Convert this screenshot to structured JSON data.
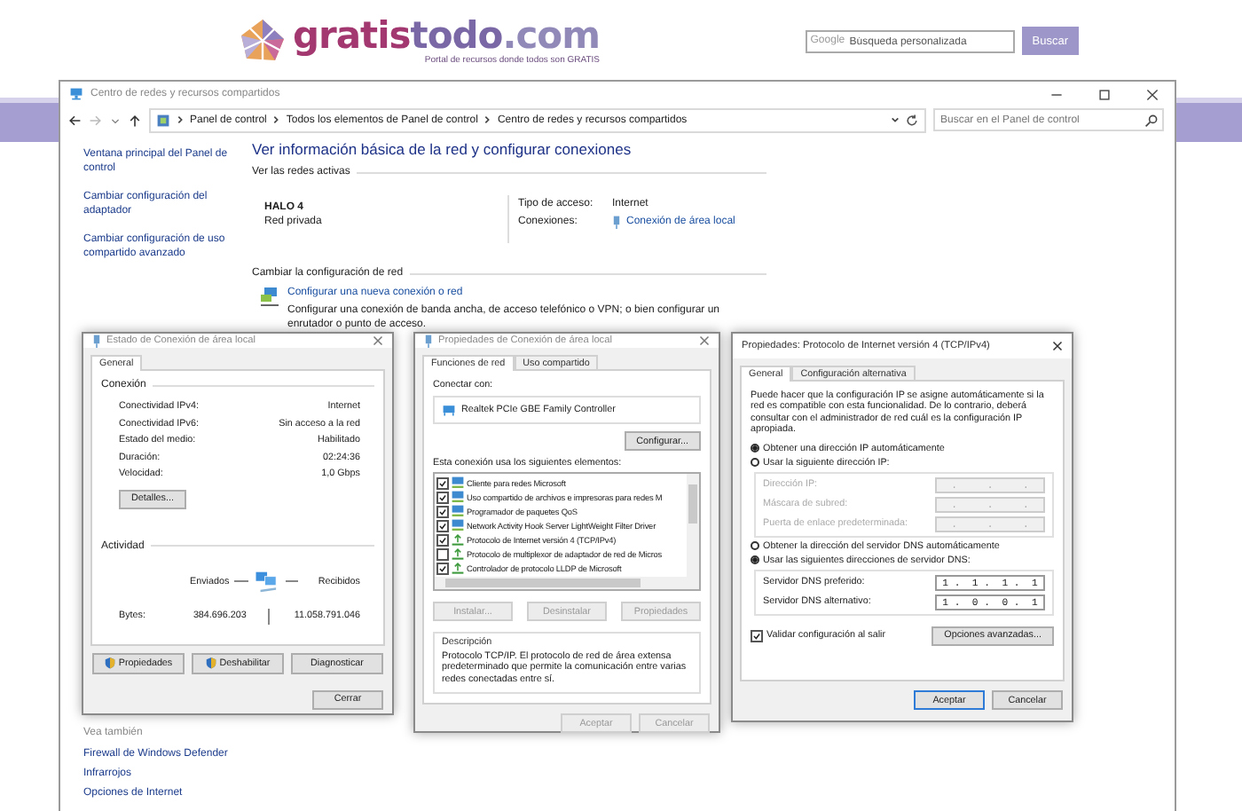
{
  "site_header": {
    "logo_parts": [
      {
        "text": "gratis",
        "color": "#a2386f"
      },
      {
        "text": "todo",
        "color": "#7a68a6"
      },
      {
        "text": ".com",
        "color": "#918ab9"
      }
    ],
    "tagline": "Portal de recursos donde todos son GRATIS",
    "search": {
      "brand": "Google",
      "placeholder": "Búsqueda personalizada"
    },
    "search_button": "Buscar"
  },
  "window": {
    "title": "Centro de redes y recursos compartidos",
    "breadcrumb": [
      "Panel de control",
      "Todos los elementos de Panel de control",
      "Centro de redes y recursos compartidos"
    ],
    "search": {
      "placeholder": "Buscar en el Panel de control"
    },
    "sidebar": {
      "items": [
        "Ventana principal del Panel de control",
        "Cambiar configuración del adaptador",
        "Cambiar configuración de uso compartido avanzado"
      ],
      "see_also_heading": "Vea también",
      "see_also": [
        "Firewall de Windows Defender",
        "Infrarrojos",
        "Opciones de Internet"
      ]
    },
    "heading": "Ver información básica de la red y configurar conexiones",
    "active_networks": {
      "heading": "Ver las redes activas",
      "name": "HALO 4",
      "category": "Red privada",
      "access_label": "Tipo de acceso:",
      "access_value": "Internet",
      "connections_label": "Conexiones:",
      "connections_value": "Conexión de área local"
    },
    "change_settings": {
      "heading": "Cambiar la configuración de red",
      "link": "Configurar una nueva conexión o red",
      "description": "Configurar una conexión de banda ancha, de acceso telefónico o VPN; o bien configurar un enrutador o punto de acceso."
    }
  },
  "status_dialog": {
    "title": "Estado de Conexión de área local",
    "tabs": [
      {
        "label": "General",
        "selected": true
      }
    ],
    "connection_heading": "Conexión",
    "rows": [
      {
        "label": "Conectividad IPv4:",
        "value": "Internet"
      },
      {
        "label": "Conectividad IPv6:",
        "value": "Sin acceso a la red"
      },
      {
        "label": "Estado del medio:",
        "value": "Habilitado"
      },
      {
        "label": "Duración:",
        "value": "02:24:36"
      },
      {
        "label": "Velocidad:",
        "value": "1,0 Gbps"
      }
    ],
    "details_button": "Detalles...",
    "activity_heading": "Actividad",
    "sent_label": "Enviados",
    "received_label": "Recibidos",
    "bytes_label": "Bytes:",
    "bytes_sent": "384.696.203",
    "bytes_received": "11.058.791.046",
    "buttons": [
      {
        "label": "Propiedades",
        "kind": "shield"
      },
      {
        "label": "Deshabilitar",
        "kind": "shield"
      },
      {
        "label": "Diagnosticar",
        "kind": "plain"
      }
    ],
    "close_button": "Cerrar"
  },
  "properties_dialog": {
    "title": "Propiedades de Conexión de área local",
    "tabs": [
      {
        "label": "Funciones de red",
        "selected": true
      },
      {
        "label": "Uso compartido",
        "selected": false
      }
    ],
    "connect_label": "Conectar con:",
    "adapter": "Realtek PCIe GBE Family Controller",
    "configure_button": "Configurar...",
    "items_label": "Esta conexión usa los siguientes elementos:",
    "items": [
      {
        "label": "Cliente para redes Microsoft",
        "checked": true,
        "kind": "client"
      },
      {
        "label": "Uso compartido de archivos e impresoras para redes M",
        "checked": true,
        "kind": "client"
      },
      {
        "label": "Programador de paquetes QoS",
        "checked": true,
        "kind": "client"
      },
      {
        "label": "Network Activity Hook Server LightWeight Filter Driver",
        "checked": true,
        "kind": "client"
      },
      {
        "label": "Protocolo de Internet versión 4 (TCP/IPv4)",
        "checked": true,
        "kind": "protocol"
      },
      {
        "label": "Protocolo de multiplexor de adaptador de red de Micros",
        "checked": false,
        "kind": "protocol"
      },
      {
        "label": "Controlador de protocolo LLDP de Microsoft",
        "checked": true,
        "kind": "protocol"
      }
    ],
    "item_buttons": [
      {
        "label": "Instalar...",
        "disabled": true
      },
      {
        "label": "Desinstalar",
        "disabled": true
      },
      {
        "label": "Propiedades",
        "disabled": true
      }
    ],
    "description_heading": "Descripción",
    "description": "Protocolo TCP/IP. El protocolo de red de área extensa predeterminado que permite la comunicación entre varias redes conectadas entre sí.",
    "footer_buttons": [
      {
        "label": "Aceptar",
        "disabled": true
      },
      {
        "label": "Cancelar",
        "disabled": true
      }
    ]
  },
  "ipv4_dialog": {
    "title": "Propiedades: Protocolo de Internet versión 4 (TCP/IPv4)",
    "tabs": [
      {
        "label": "General",
        "selected": true
      },
      {
        "label": "Configuración alternativa",
        "selected": false
      }
    ],
    "intro": "Puede hacer que la configuración IP se asigne automáticamente si la red es compatible con esta funcionalidad. De lo contrario, deberá consultar con el administrador de red cuál es la configuración IP apropiada.",
    "ip_options": [
      {
        "label": "Obtener una dirección IP automáticamente",
        "selected": true
      },
      {
        "label": "Usar la siguiente dirección IP:",
        "selected": false
      }
    ],
    "ip_fields": [
      {
        "label": "Dirección IP:",
        "value": ".     .     .",
        "disabled": true
      },
      {
        "label": "Máscara de subred:",
        "value": ".     .     .",
        "disabled": true
      },
      {
        "label": "Puerta de enlace predeterminada:",
        "value": ".     .     .",
        "disabled": true
      }
    ],
    "dns_options": [
      {
        "label": "Obtener la dirección del servidor DNS automáticamente",
        "selected": false
      },
      {
        "label": "Usar las siguientes direcciones de servidor DNS:",
        "selected": true
      }
    ],
    "dns_fields": [
      {
        "label": "Servidor DNS preferido:",
        "value": "1 .  1 .  1 .  1",
        "disabled": false
      },
      {
        "label": "Servidor DNS alternativo:",
        "value": "1 .  0 .  0 .  1",
        "disabled": false
      }
    ],
    "validate": {
      "label": "Validar configuración al salir",
      "checked": true
    },
    "advanced_button": "Opciones avanzadas...",
    "footer_buttons": [
      {
        "label": "Aceptar",
        "default": true
      },
      {
        "label": "Cancelar",
        "default": false
      }
    ]
  }
}
